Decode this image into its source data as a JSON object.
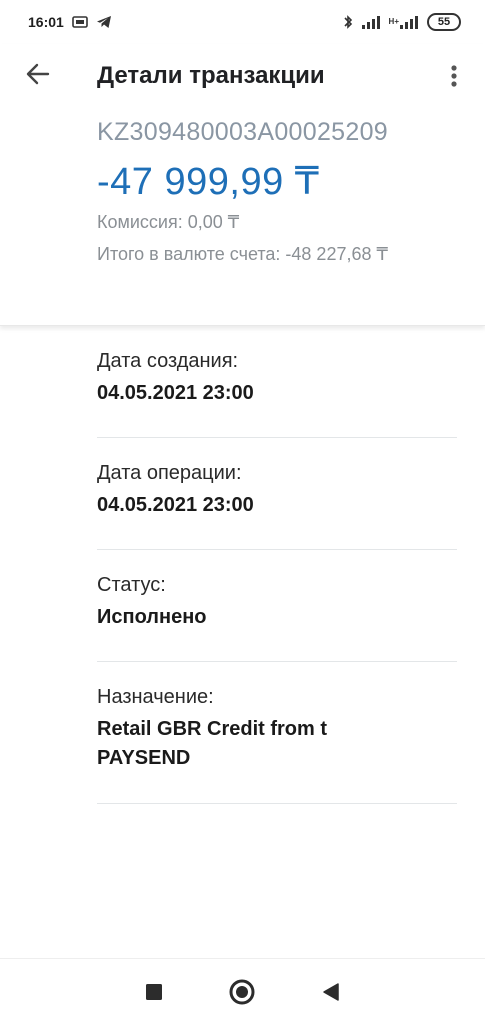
{
  "status_bar": {
    "time": "16:01",
    "battery": "55",
    "net_label": "H+"
  },
  "header": {
    "title": "Детали транзакции",
    "account": "KZ309480003A00025209",
    "amount": "-47 999,99 ₸",
    "commission": "Комиссия: 0,00 ₸",
    "total": "Итого в валюте счета: -48 227,68 ₸"
  },
  "details": [
    {
      "label": "Дата создания:",
      "value": "04.05.2021 23:00"
    },
    {
      "label": "Дата операции:",
      "value": "04.05.2021 23:00"
    },
    {
      "label": "Статус:",
      "value": "Исполнено"
    },
    {
      "label": "Назначение:",
      "value": "Retail GBR Credit from t PAYSEND"
    }
  ],
  "colors": {
    "amount": "#1e6fb7",
    "account": "#8a96a3",
    "secondary": "#8a8f94"
  },
  "icons": {
    "back": "arrow-left-icon",
    "more": "more-vertical-icon",
    "nav_recents": "square-icon",
    "nav_home": "circle-icon",
    "nav_back": "triangle-back-icon"
  }
}
